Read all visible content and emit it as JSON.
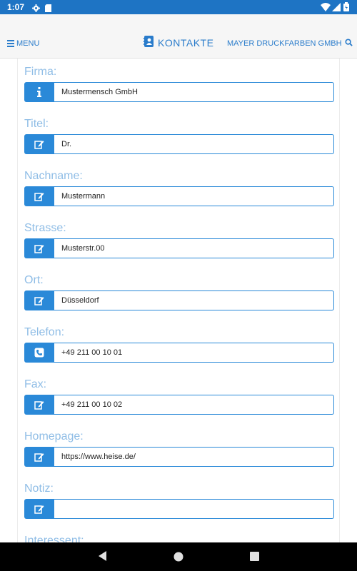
{
  "status_bar": {
    "time": "1:07"
  },
  "header": {
    "menu_label": "MENU",
    "title": "KONTAKTE",
    "company": "MAYER DRUCKFARBEN GMBH"
  },
  "fields": [
    {
      "label": "Firma:",
      "value": "Mustermensch GmbH",
      "icon": "info-icon"
    },
    {
      "label": "Titel:",
      "value": "Dr.",
      "icon": "edit-icon"
    },
    {
      "label": "Nachname:",
      "value": "Mustermann",
      "icon": "edit-icon"
    },
    {
      "label": "Strasse:",
      "value": "Musterstr.00",
      "icon": "edit-icon"
    },
    {
      "label": "Ort:",
      "value": "Düsseldorf",
      "icon": "edit-icon"
    },
    {
      "label": "Telefon:",
      "value": "+49 211 00 10 01",
      "icon": "phone-icon"
    },
    {
      "label": "Fax:",
      "value": "+49 211 00 10 02",
      "icon": "edit-icon"
    },
    {
      "label": "Homepage:",
      "value": "https://www.heise.de/",
      "icon": "edit-icon"
    },
    {
      "label": "Notiz:",
      "value": "",
      "icon": "edit-icon"
    },
    {
      "label": "Interessent:",
      "value": "",
      "icon": "edit-icon"
    }
  ],
  "colors": {
    "accent": "#2a89d8",
    "status_bar": "#1e74c4",
    "label": "#8fbde6",
    "header_text": "#2a7ccb"
  }
}
